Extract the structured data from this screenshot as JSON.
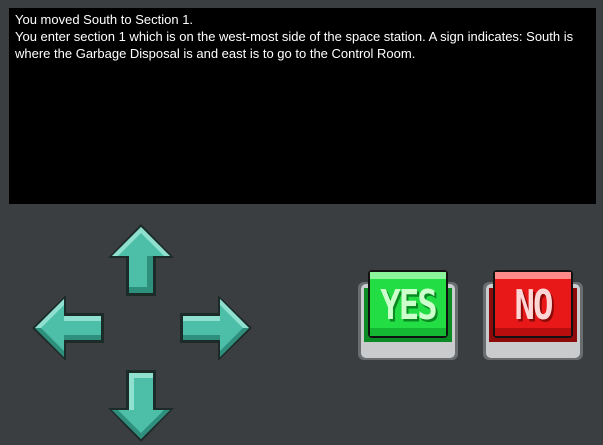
{
  "console": {
    "lines": [
      "You moved South to Section 1.",
      "You enter section 1 which is on the west-most side of the space station. A sign indicates: South is where the Garbage Disposal is and east is to go to the Control Room."
    ]
  },
  "controls": {
    "dpad": {
      "up_icon": "arrow-up-icon",
      "down_icon": "arrow-down-icon",
      "left_icon": "arrow-left-icon",
      "right_icon": "arrow-right-icon",
      "color": "#4dbfa8"
    },
    "yes_label": "YES",
    "no_label": "NO",
    "yes_color": "#22dd44",
    "no_color": "#e81818"
  }
}
